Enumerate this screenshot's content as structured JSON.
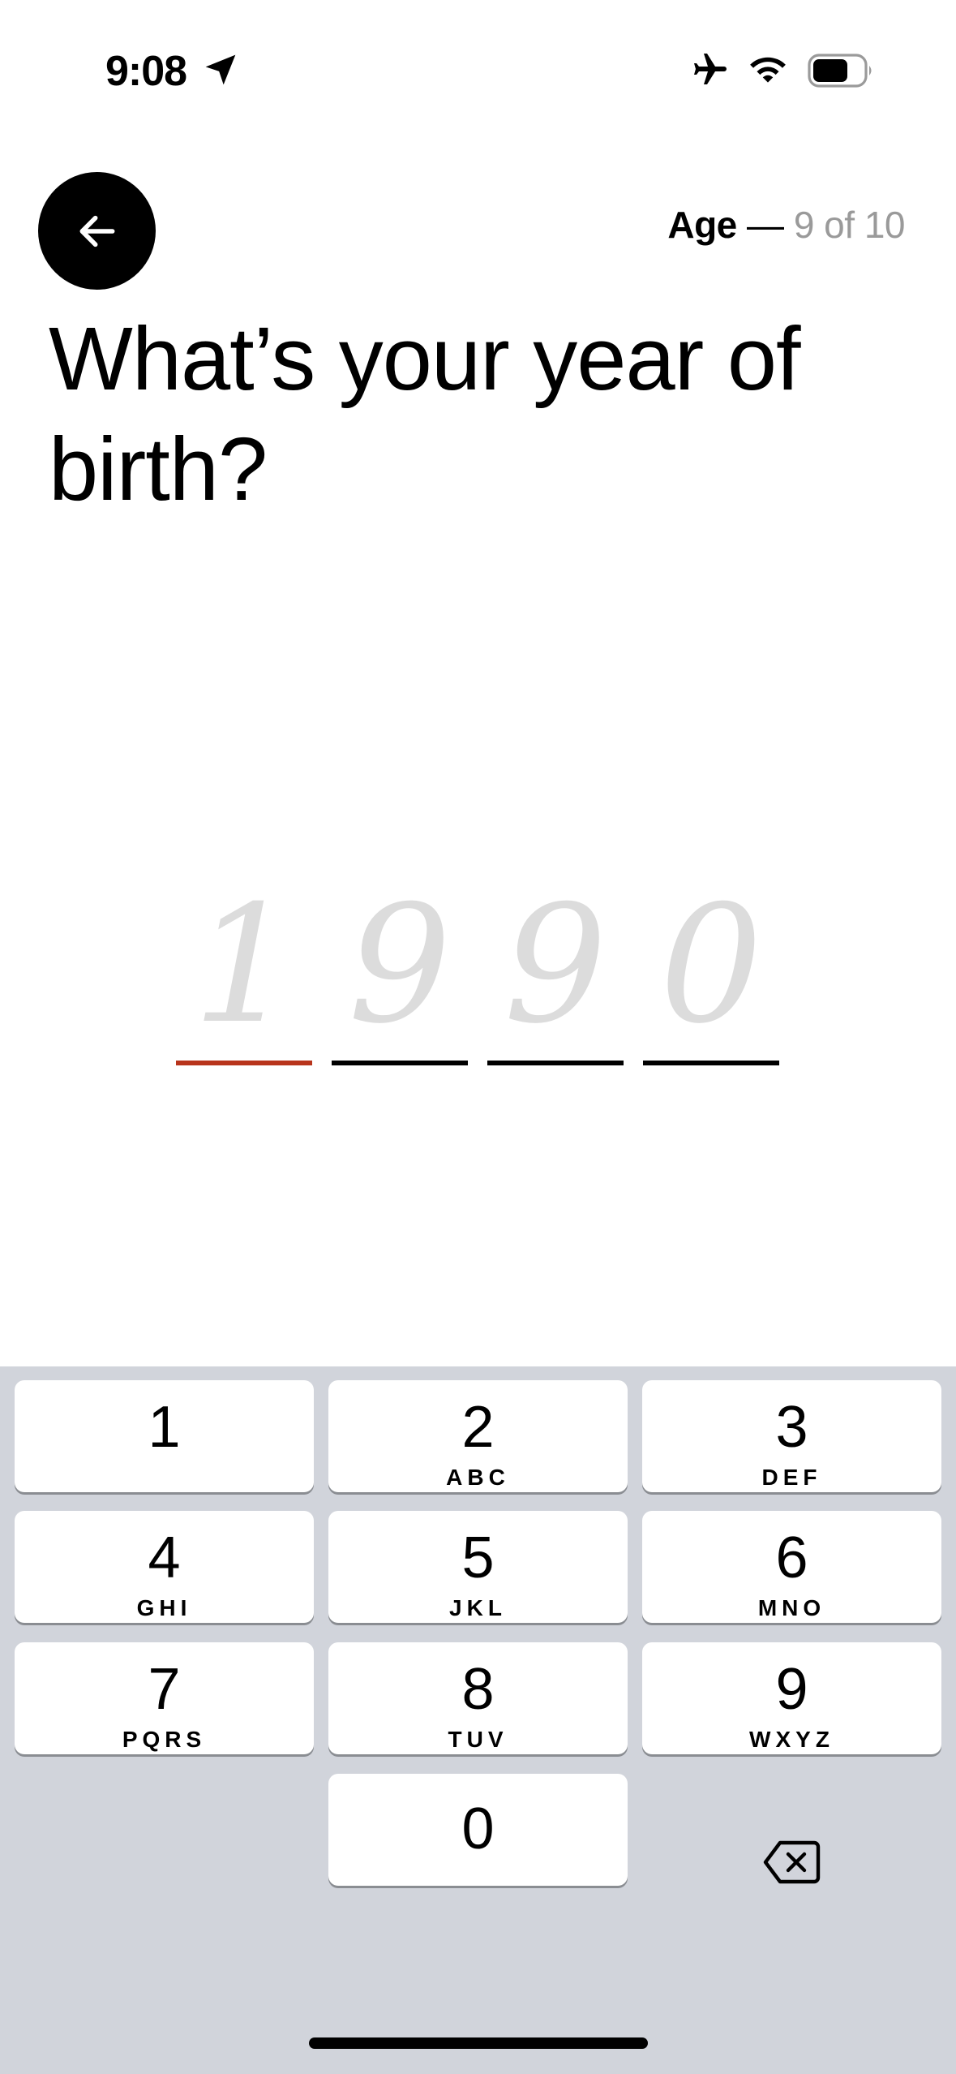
{
  "status_bar": {
    "time": "9:08"
  },
  "header": {
    "section": "Age",
    "separator": " — ",
    "progress": "9 of 10"
  },
  "question": {
    "title": "What’s your year of birth?"
  },
  "year_input": {
    "placeholder_digits": [
      "1",
      "9",
      "9",
      "0"
    ],
    "active_index": 0,
    "active_color": "#b8341c"
  },
  "keypad": {
    "keys": [
      {
        "digit": "1",
        "letters": ""
      },
      {
        "digit": "2",
        "letters": "ABC"
      },
      {
        "digit": "3",
        "letters": "DEF"
      },
      {
        "digit": "4",
        "letters": "GHI"
      },
      {
        "digit": "5",
        "letters": "JKL"
      },
      {
        "digit": "6",
        "letters": "MNO"
      },
      {
        "digit": "7",
        "letters": "PQRS"
      },
      {
        "digit": "8",
        "letters": "TUV"
      },
      {
        "digit": "9",
        "letters": "WXYZ"
      },
      {
        "digit": "0",
        "letters": ""
      }
    ],
    "delete_icon": "backspace-icon"
  }
}
